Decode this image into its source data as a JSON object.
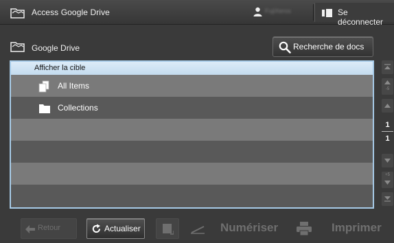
{
  "titlebar": {
    "title": "Access Google Drive",
    "user_name": "FujiXerox",
    "logout_label": "Se déconnecter"
  },
  "location": {
    "title": "Google Drive",
    "search_label": "Recherche de docs"
  },
  "list": {
    "header": "Afficher la cible",
    "items": [
      {
        "label": "All Items",
        "icon": "document-stack-icon"
      },
      {
        "label": "Collections",
        "icon": "folder-icon"
      }
    ]
  },
  "pager": {
    "current": "1",
    "total": "1",
    "step_up": "-5",
    "step_down": "+5"
  },
  "toolbar": {
    "back_label": "Retour",
    "refresh_label": "Actualiser",
    "scan_label": "Numériser",
    "print_label": "Imprimer"
  },
  "colors": {
    "accent_border": "#a7cbe8",
    "header_bg": "#dcebf8",
    "row_light": "#7a7a7a",
    "row_dark": "#595959",
    "background": "#3a3a3a"
  }
}
